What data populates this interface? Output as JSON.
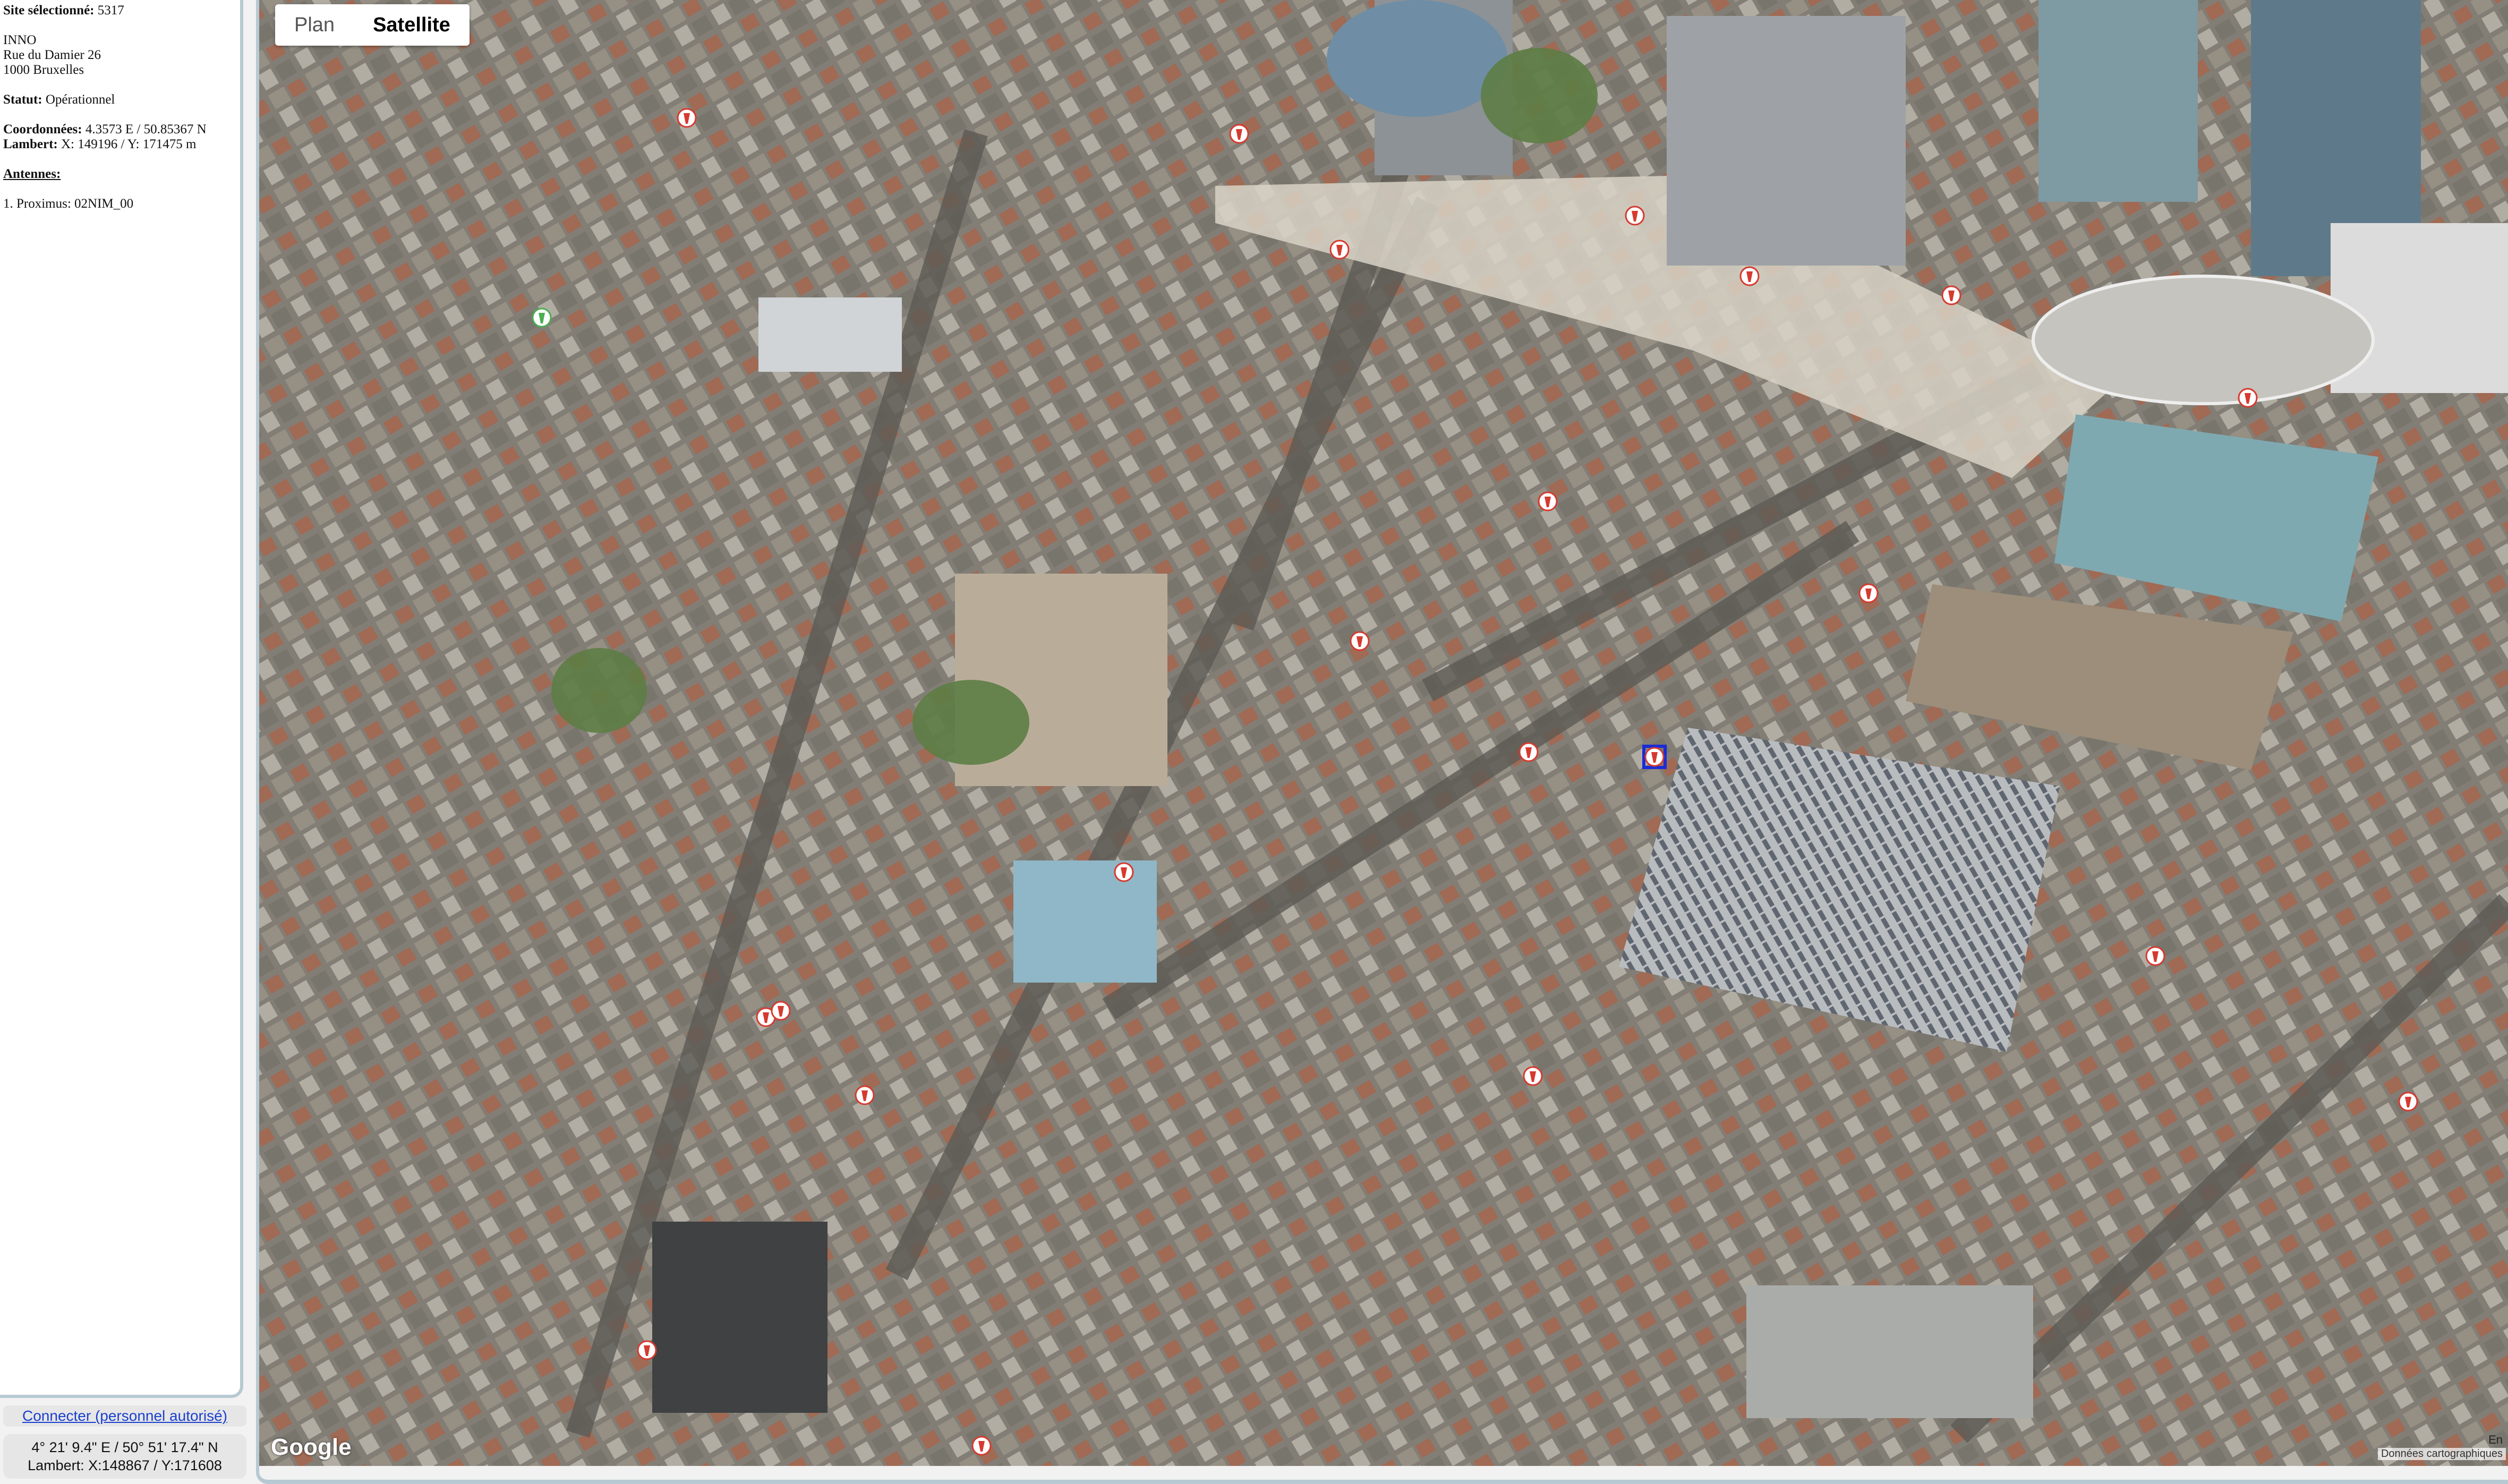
{
  "side_panel": {
    "site_label": "Site sélectionné:",
    "site_id": "5317",
    "name": "INNO",
    "address_line1": "Rue du Damier 26",
    "address_line2": "1000 Bruxelles",
    "status_label": "Statut:",
    "status_value": "Opérationnel",
    "coords_label": "Coordonnées:",
    "coords_value": "4.3573 E / 50.85367 N",
    "lambert_label": "Lambert:",
    "lambert_value": "X: 149196 / Y: 171475 m",
    "antennas_label": "Antennes:",
    "antennas": [
      "1. Proximus: 02NIM_00"
    ]
  },
  "login_link": "Connecter (personnel autorisé)",
  "cursor_coords": {
    "line1": "4° 21' 9.4\" E / 50° 51' 17.4\" N",
    "line2": "Lambert: X:148867 / Y:171608"
  },
  "map": {
    "type_toggle": {
      "plan": "Plan",
      "satellite": "Satellite",
      "selected": "satellite"
    },
    "brand": "Google",
    "attribution": "Données cartographiques",
    "lang": "En",
    "colors": {
      "marker_red": "#d63a2f",
      "marker_green": "#4caf50",
      "selected_frame": "#1a2bd8"
    },
    "markers": [
      {
        "id": "m1",
        "kind": "red"
      },
      {
        "id": "m2",
        "kind": "red"
      },
      {
        "id": "m3",
        "kind": "red"
      },
      {
        "id": "m4",
        "kind": "red"
      },
      {
        "id": "m5",
        "kind": "red"
      },
      {
        "id": "m6",
        "kind": "red"
      },
      {
        "id": "m7",
        "kind": "red"
      },
      {
        "id": "m8",
        "kind": "red"
      },
      {
        "id": "m9",
        "kind": "red"
      },
      {
        "id": "m10",
        "kind": "red"
      },
      {
        "id": "m11",
        "kind": "red"
      },
      {
        "id": "m12",
        "kind": "red"
      },
      {
        "id": "m13",
        "kind": "red"
      },
      {
        "id": "m14",
        "kind": "red"
      },
      {
        "id": "m15",
        "kind": "red"
      },
      {
        "id": "m16",
        "kind": "red"
      },
      {
        "id": "m17",
        "kind": "red"
      },
      {
        "id": "m18",
        "kind": "red"
      },
      {
        "id": "m19",
        "kind": "red"
      },
      {
        "id": "m20",
        "kind": "red"
      },
      {
        "id": "m21",
        "kind": "green"
      },
      {
        "id": "m22",
        "kind": "selected"
      }
    ]
  }
}
